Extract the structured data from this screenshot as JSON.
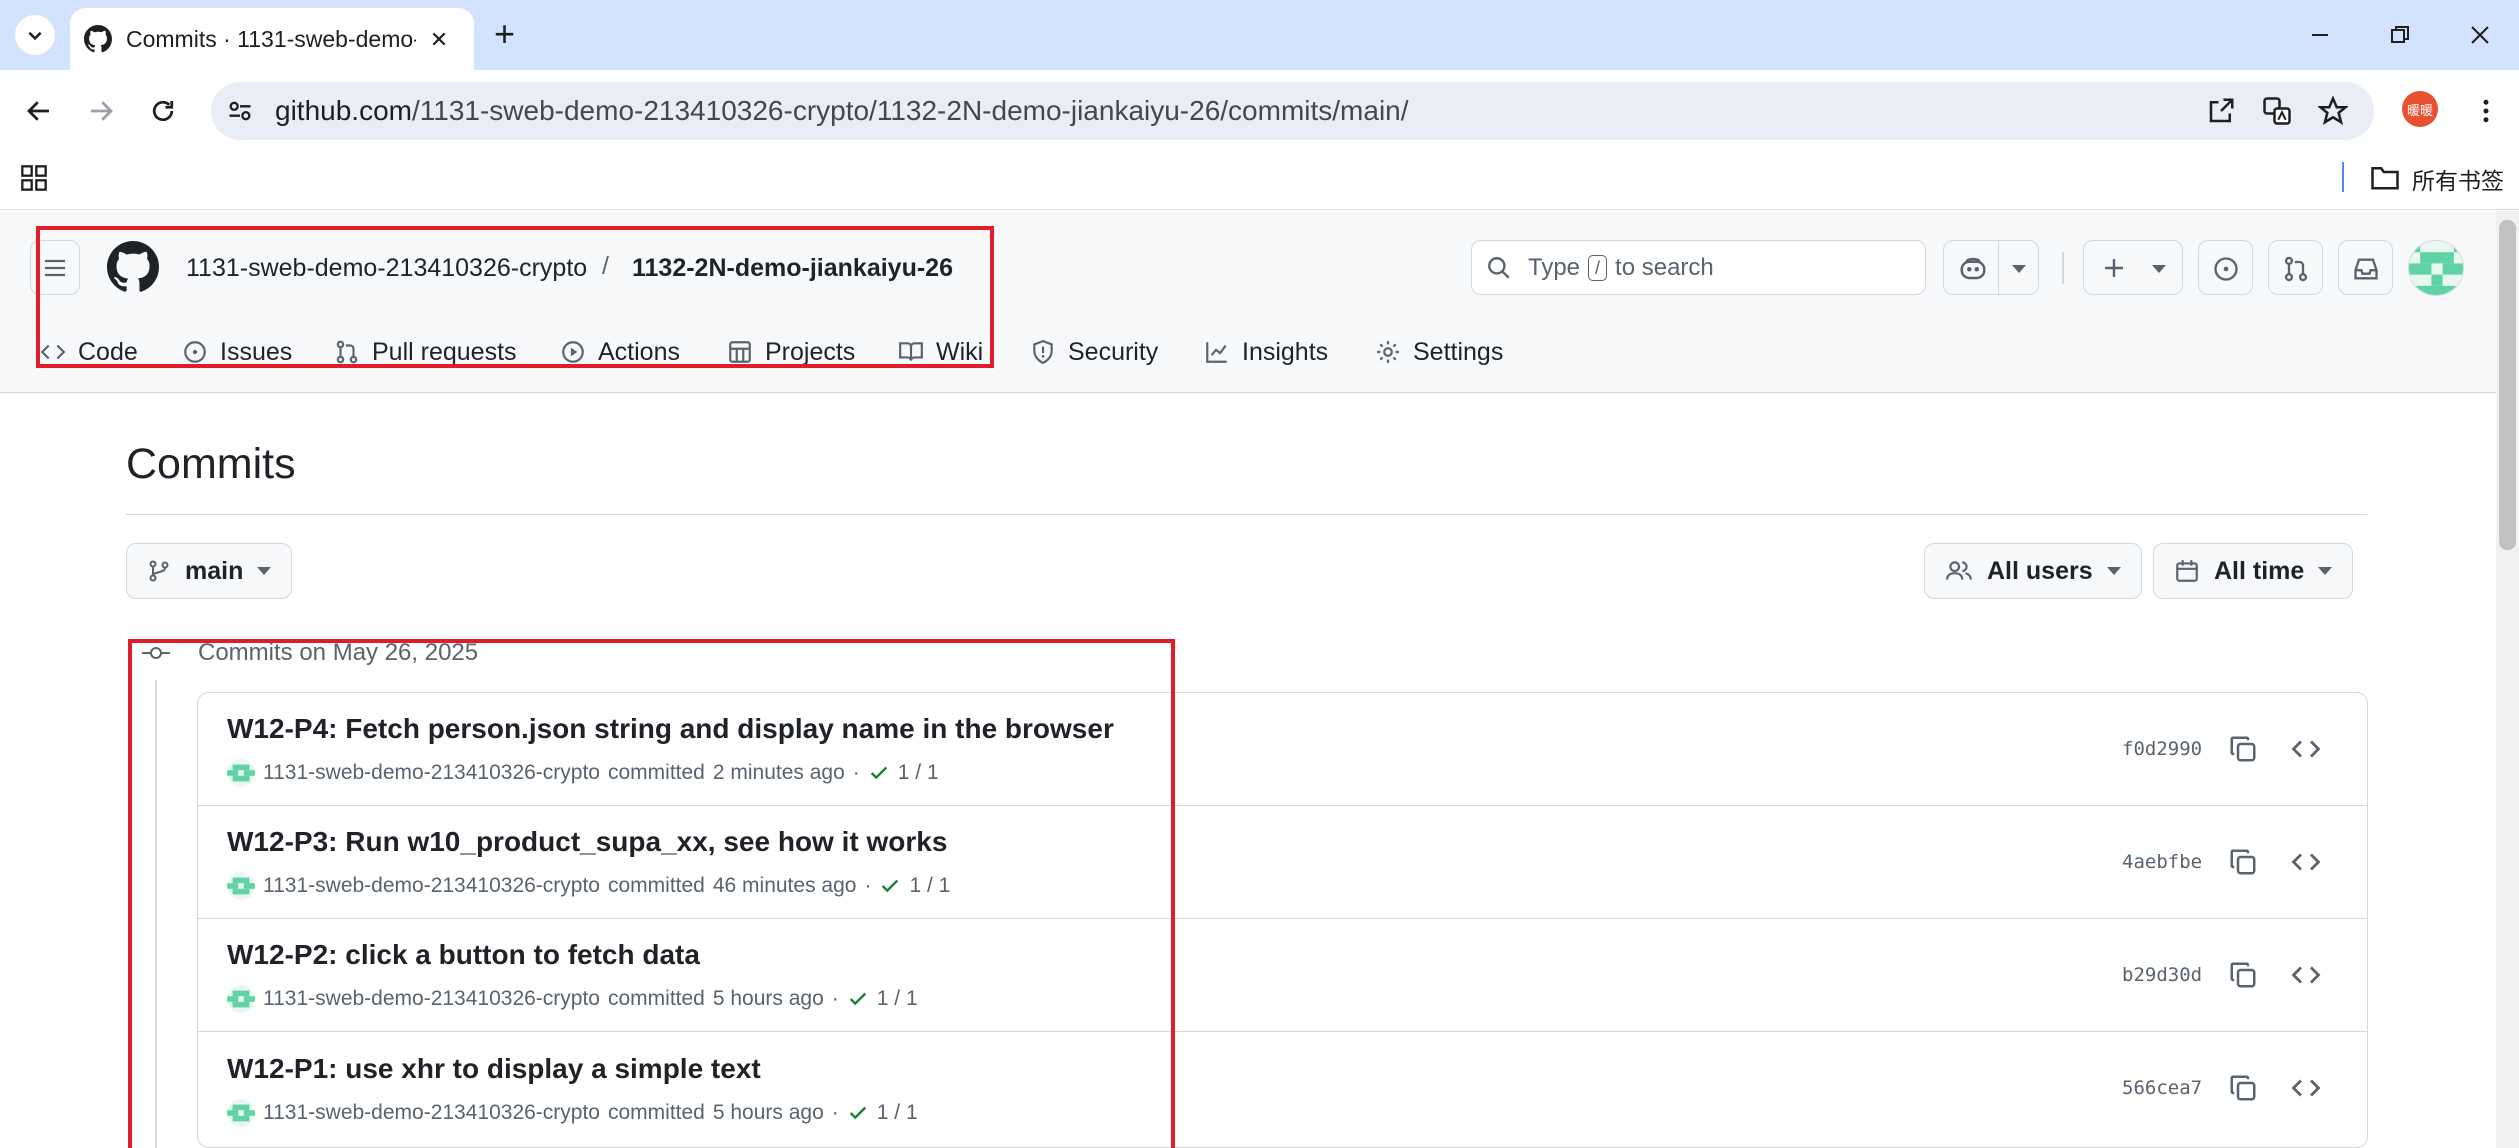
{
  "browser": {
    "tab_title": "Commits · 1131-sweb-demo-",
    "new_tab": "+",
    "url_host": "github.com",
    "url_path": "/1131-sweb-demo-213410326-crypto/1132-2N-demo-jiankaiyu-26/commits/main/",
    "profile_badge": "暖暖",
    "all_bookmarks": "所有书签"
  },
  "repo": {
    "owner": "1131-sweb-demo-213410326-crypto",
    "separator": "/",
    "name": "1132-2N-demo-jiankaiyu-26"
  },
  "search": {
    "prefix": "Type",
    "key": "/",
    "suffix": "to search"
  },
  "nav": [
    {
      "label": "Code",
      "icon": "code-icon"
    },
    {
      "label": "Issues",
      "icon": "issue-icon"
    },
    {
      "label": "Pull requests",
      "icon": "pull-request-icon"
    },
    {
      "label": "Actions",
      "icon": "play-icon"
    },
    {
      "label": "Projects",
      "icon": "table-icon"
    },
    {
      "label": "Wiki",
      "icon": "book-icon"
    },
    {
      "label": "Security",
      "icon": "shield-icon"
    },
    {
      "label": "Insights",
      "icon": "graph-icon"
    },
    {
      "label": "Settings",
      "icon": "gear-icon"
    }
  ],
  "page": {
    "title": "Commits",
    "branch": "main",
    "users_filter": "All users",
    "time_filter": "All time",
    "group_title": "Commits on May 26, 2025"
  },
  "commits": [
    {
      "message": "W12-P4: Fetch person.json string and display name in the browser",
      "author": "1131-sweb-demo-213410326-crypto",
      "verb": "committed",
      "time": "2 minutes ago",
      "checks": "1 / 1",
      "sha": "f0d2990"
    },
    {
      "message": "W12-P3: Run w10_product_supa_xx, see how it works",
      "author": "1131-sweb-demo-213410326-crypto",
      "verb": "committed",
      "time": "46 minutes ago",
      "checks": "1 / 1",
      "sha": "4aebfbe"
    },
    {
      "message": "W12-P2: click a button to fetch data",
      "author": "1131-sweb-demo-213410326-crypto",
      "verb": "committed",
      "time": "5 hours ago",
      "checks": "1 / 1",
      "sha": "b29d30d"
    },
    {
      "message": "W12-P1: use xhr to display a simple text",
      "author": "1131-sweb-demo-213410326-crypto",
      "verb": "committed",
      "time": "5 hours ago",
      "checks": "1 / 1",
      "sha": "566cea7"
    }
  ],
  "colors": {
    "annotation_red": "#e01e2b",
    "success_green": "#1a7f37",
    "tabstrip": "#d3e3fd"
  }
}
